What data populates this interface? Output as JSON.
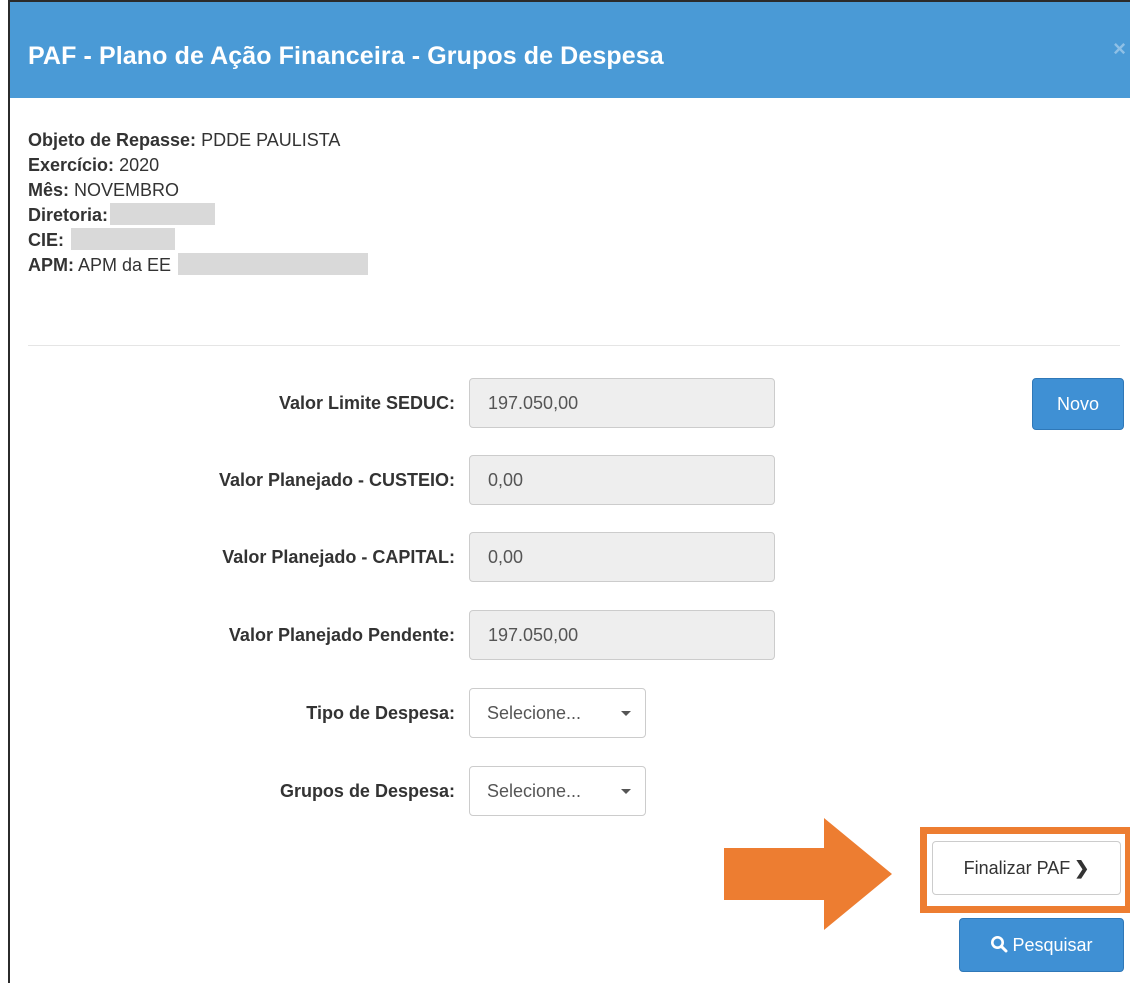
{
  "modal": {
    "title": "PAF - Plano de Ação Financeira - Grupos de Despesa",
    "close_symbol": "×"
  },
  "info": {
    "objeto_label": "Objeto de Repasse:",
    "objeto_value": "PDDE PAULISTA",
    "exercicio_label": "Exercício:",
    "exercicio_value": "2020",
    "mes_label": "Mês:",
    "mes_value": "NOVEMBRO",
    "diretoria_label": "Diretoria:",
    "cie_label": "CIE:",
    "apm_label": "APM:",
    "apm_value": "APM da EE"
  },
  "form": {
    "valor_limite_label": "Valor Limite SEDUC:",
    "valor_limite_value": "197.050,00",
    "custeio_label": "Valor Planejado - CUSTEIO:",
    "custeio_value": "0,00",
    "capital_label": "Valor Planejado - CAPITAL:",
    "capital_value": "0,00",
    "pendente_label": "Valor Planejado Pendente:",
    "pendente_value": "197.050,00",
    "tipo_label": "Tipo de Despesa:",
    "tipo_selected": "Selecione...",
    "grupos_label": "Grupos de Despesa:",
    "grupos_selected": "Selecione..."
  },
  "buttons": {
    "novo": "Novo",
    "finalizar": "Finalizar PAF",
    "finalizar_chevron": "❯",
    "pesquisar": "Pesquisar"
  },
  "colors": {
    "header": "#4a9ad6",
    "primary_button": "#3f90d4",
    "highlight": "#ed7d31"
  },
  "icons": {
    "close": "close-icon",
    "search": "search-icon",
    "chevron": "chevron-right-icon",
    "caret": "caret-down-icon",
    "arrow": "arrow-right-icon"
  }
}
